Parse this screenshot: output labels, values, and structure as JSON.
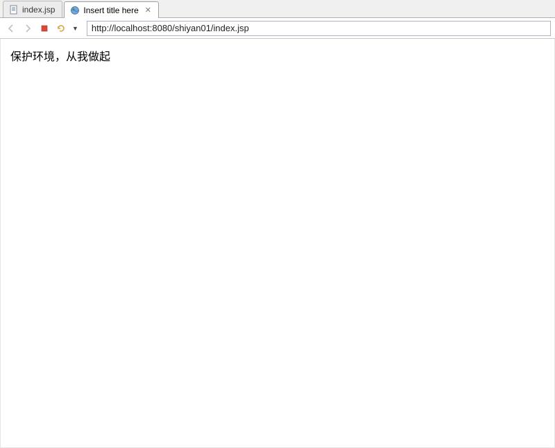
{
  "tabs": {
    "file": {
      "label": "index.jsp"
    },
    "browser": {
      "label": "Insert title here"
    }
  },
  "toolbar": {
    "url": "http://localhost:8080/shiyan01/index.jsp"
  },
  "page": {
    "body_text": "保护环境，从我做起"
  }
}
